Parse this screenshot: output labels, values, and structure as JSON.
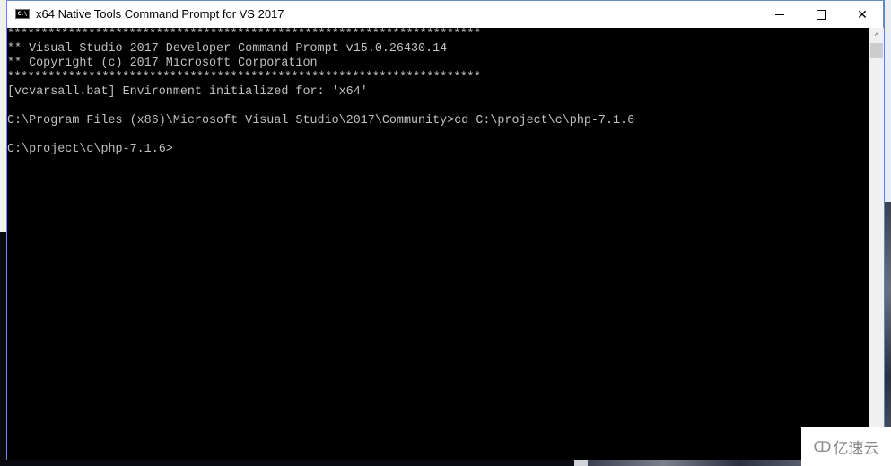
{
  "window": {
    "title": "x64 Native Tools Command Prompt for VS 2017",
    "icon_label": "C:\\",
    "controls": {
      "minimize": "minimize",
      "maximize": "maximize",
      "close": "✕"
    }
  },
  "console": {
    "lines": [
      "**********************************************************************",
      "** Visual Studio 2017 Developer Command Prompt v15.0.26430.14",
      "** Copyright (c) 2017 Microsoft Corporation",
      "**********************************************************************",
      "[vcvarsall.bat] Environment initialized for: 'x64'",
      "",
      "C:\\Program Files (x86)\\Microsoft Visual Studio\\2017\\Community>cd C:\\project\\c\\php-7.1.6",
      "",
      "C:\\project\\c\\php-7.1.6>"
    ]
  },
  "scrollbar": {
    "up_arrow": "^"
  },
  "watermark": {
    "logo": "ↀ",
    "text": "亿速云"
  }
}
